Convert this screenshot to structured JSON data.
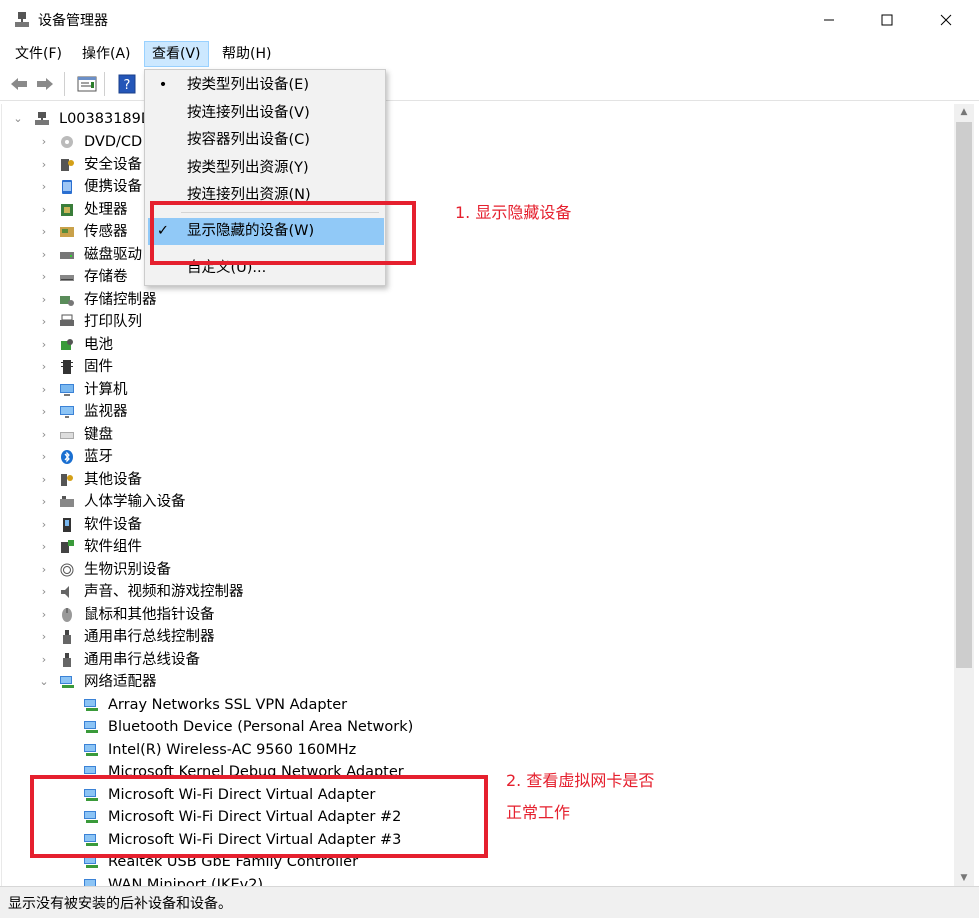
{
  "window": {
    "title": "设备管理器",
    "minimize": "—",
    "maximize": "☐",
    "close": "✕"
  },
  "menu": {
    "items": [
      {
        "label": "文件(F)"
      },
      {
        "label": "操作(A)"
      },
      {
        "label": "查看(V)"
      },
      {
        "label": "帮助(H)"
      }
    ],
    "active": "查看(V)"
  },
  "toolbar": {
    "buttons": [
      "back-icon",
      "forward-icon",
      "properties-icon",
      "help-icon"
    ]
  },
  "view_menu": {
    "items": [
      {
        "label": "按类型列出设备(E)",
        "mark": "•"
      },
      {
        "label": "按连接列出设备(V)",
        "mark": ""
      },
      {
        "label": "按容器列出设备(C)",
        "mark": ""
      },
      {
        "label": "按类型列出资源(Y)",
        "mark": ""
      },
      {
        "label": "按连接列出资源(N)",
        "mark": ""
      },
      {
        "label": "显示隐藏的设备(W)",
        "mark": "✓"
      },
      {
        "label": "自定义(U)...",
        "mark": ""
      }
    ]
  },
  "tree": {
    "root": "L00383189D",
    "categories": [
      {
        "label": "DVD/CD",
        "icon": "dvd-icon"
      },
      {
        "label": "安全设备",
        "icon": "security-device-icon"
      },
      {
        "label": "便携设备",
        "icon": "portable-device-icon"
      },
      {
        "label": "处理器",
        "icon": "processor-icon"
      },
      {
        "label": "传感器",
        "icon": "sensor-icon"
      },
      {
        "label": "磁盘驱动",
        "icon": "disk-drive-icon"
      },
      {
        "label": "存储卷",
        "icon": "storage-volume-icon"
      },
      {
        "label": "存储控制器",
        "icon": "storage-controller-icon"
      },
      {
        "label": "打印队列",
        "icon": "printer-icon"
      },
      {
        "label": "电池",
        "icon": "battery-icon"
      },
      {
        "label": "固件",
        "icon": "firmware-icon"
      },
      {
        "label": "计算机",
        "icon": "computer-icon"
      },
      {
        "label": "监视器",
        "icon": "monitor-icon"
      },
      {
        "label": "键盘",
        "icon": "keyboard-icon"
      },
      {
        "label": "蓝牙",
        "icon": "bluetooth-icon"
      },
      {
        "label": "其他设备",
        "icon": "other-device-icon"
      },
      {
        "label": "人体学输入设备",
        "icon": "hid-icon"
      },
      {
        "label": "软件设备",
        "icon": "software-device-icon"
      },
      {
        "label": "软件组件",
        "icon": "software-component-icon"
      },
      {
        "label": "生物识别设备",
        "icon": "biometric-icon"
      },
      {
        "label": "声音、视频和游戏控制器",
        "icon": "sound-icon"
      },
      {
        "label": "鼠标和其他指针设备",
        "icon": "mouse-icon"
      },
      {
        "label": "通用串行总线控制器",
        "icon": "usb-icon"
      },
      {
        "label": "通用串行总线设备",
        "icon": "usb-icon"
      },
      {
        "label": "网络适配器",
        "icon": "network-adapter-icon"
      }
    ],
    "network_children": [
      "Array Networks SSL VPN Adapter",
      "Bluetooth Device (Personal Area Network)",
      "Intel(R) Wireless-AC 9560 160MHz",
      "Microsoft Kernel Debug Network Adapter",
      "Microsoft Wi-Fi Direct Virtual Adapter",
      "Microsoft Wi-Fi Direct Virtual Adapter #2",
      "Microsoft Wi-Fi Direct Virtual Adapter #3",
      "Realtek USB GbE Family Controller",
      "WAN Miniport (IKEv2)"
    ]
  },
  "status": "显示没有被安装的后补设备和设备。",
  "annotations": {
    "note1": "1. 显示隐藏设备",
    "note2_line1": "2. 查看虚拟网卡是否",
    "note2_line2": "正常工作",
    "color": "#e5202e"
  }
}
